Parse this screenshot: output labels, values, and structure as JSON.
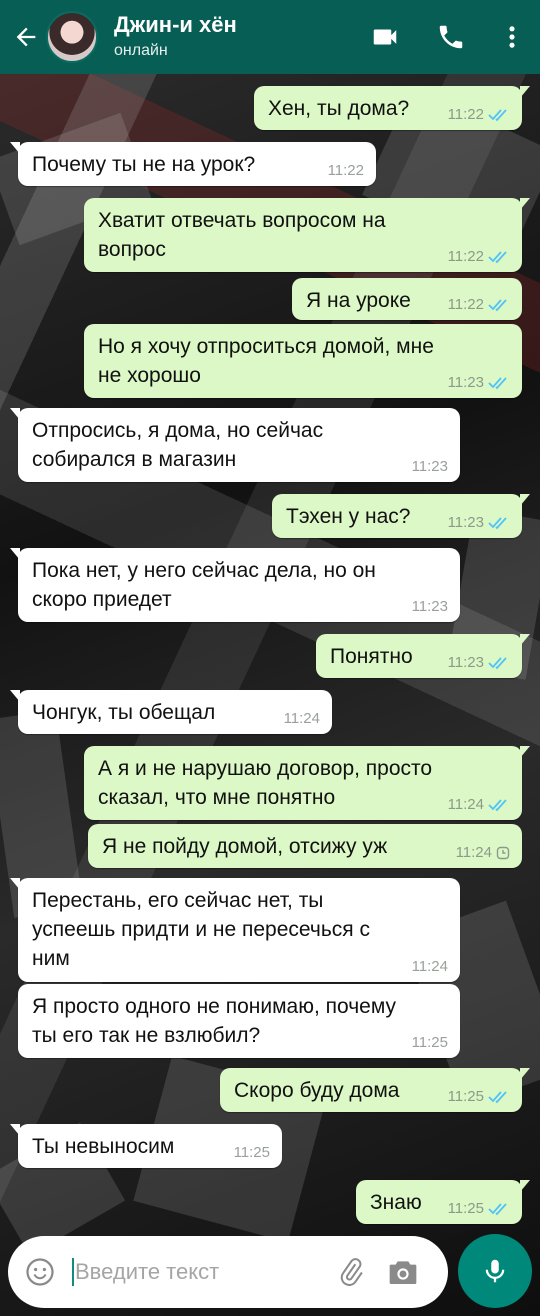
{
  "header": {
    "back_icon": "arrow-left-icon",
    "contact_name": "Джин-и хён",
    "status": "онлайн",
    "video_icon": "video-camera-icon",
    "call_icon": "phone-icon",
    "menu_icon": "more-vert-icon",
    "background": "#075e54"
  },
  "messages": [
    {
      "direction": "out",
      "text": "Хен, ты дома?",
      "time": "11:22",
      "status": "read"
    },
    {
      "direction": "in",
      "text": "Почему ты не на урок?",
      "time": "11:22"
    },
    {
      "direction": "out",
      "text": "Хватит отвечать вопросом на\nвопрос",
      "time": "11:22",
      "status": "read"
    },
    {
      "direction": "out",
      "text": "Я на уроке",
      "time": "11:22",
      "status": "read"
    },
    {
      "direction": "out",
      "text": "Но я хочу отпроситься домой, мне\nне хорошо",
      "time": "11:23",
      "status": "read"
    },
    {
      "direction": "in",
      "text": "Отпросись, я дома, но сейчас\nсобирался в магазин",
      "time": "11:23"
    },
    {
      "direction": "out",
      "text": "Тэхен у нас?",
      "time": "11:23",
      "status": "read"
    },
    {
      "direction": "in",
      "text": "Пока нет, у него сейчас дела, но он\nскоро приедет",
      "time": "11:23"
    },
    {
      "direction": "out",
      "text": "Понятно",
      "time": "11:23",
      "status": "read"
    },
    {
      "direction": "in",
      "text": "Чонгук, ты обещал",
      "time": "11:24"
    },
    {
      "direction": "out",
      "text": "А я и не нарушаю договор, просто\nсказал, что мне понятно",
      "time": "11:24",
      "status": "read"
    },
    {
      "direction": "out",
      "text": "Я не пойду домой, отсижу уж",
      "time": "11:24",
      "status": "pending"
    },
    {
      "direction": "in",
      "text": "Перестань, его сейчас нет, ты\nуспеешь придти и не пересечься с\nним",
      "time": "11:24"
    },
    {
      "direction": "in",
      "text": "Я просто одного не понимаю, почему\nты его так не взлюбил?",
      "time": "11:25"
    },
    {
      "direction": "out",
      "text": "Скоро буду дома",
      "time": "11:25",
      "status": "read"
    },
    {
      "direction": "in",
      "text": "Ты невыносим",
      "time": "11:25"
    },
    {
      "direction": "out",
      "text": "Знаю",
      "time": "11:25",
      "status": "read"
    }
  ],
  "input": {
    "placeholder": "Введите текст",
    "emoji_icon": "emoji-icon",
    "attach_icon": "paperclip-icon",
    "camera_icon": "camera-icon",
    "mic_icon": "microphone-icon"
  },
  "colors": {
    "outgoing_bubble": "#dcf8c6",
    "incoming_bubble": "#ffffff",
    "read_ticks": "#4fc3f7",
    "accent": "#00897b"
  }
}
